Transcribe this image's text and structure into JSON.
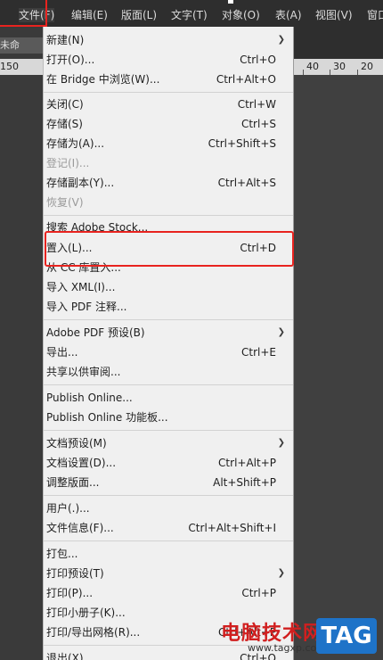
{
  "menubar": {
    "items": [
      {
        "label": "文件(F)"
      },
      {
        "label": "编辑(E)"
      },
      {
        "label": "版面(L)"
      },
      {
        "label": "文字(T)"
      },
      {
        "label": "对象(O)"
      },
      {
        "label": "表(A)"
      },
      {
        "label": "视图(V)"
      },
      {
        "label": "窗口"
      }
    ]
  },
  "document": {
    "tab_label": "未命",
    "ruler_left_text": "150",
    "ruler_right_numbers": [
      "40",
      "30",
      "20"
    ]
  },
  "file_menu": {
    "items": [
      {
        "label": "新建(N)",
        "shortcut": "",
        "submenu": true,
        "disabled": false
      },
      {
        "label": "打开(O)...",
        "shortcut": "Ctrl+O",
        "submenu": false,
        "disabled": false
      },
      {
        "label": "在 Bridge 中浏览(W)...",
        "shortcut": "Ctrl+Alt+O",
        "submenu": false,
        "disabled": false
      },
      {
        "label": "关闭(C)",
        "shortcut": "Ctrl+W",
        "submenu": false,
        "disabled": false
      },
      {
        "label": "存储(S)",
        "shortcut": "Ctrl+S",
        "submenu": false,
        "disabled": false
      },
      {
        "label": "存储为(A)...",
        "shortcut": "Ctrl+Shift+S",
        "submenu": false,
        "disabled": false
      },
      {
        "label": "登记(I)...",
        "shortcut": "",
        "submenu": false,
        "disabled": true
      },
      {
        "label": "存储副本(Y)...",
        "shortcut": "Ctrl+Alt+S",
        "submenu": false,
        "disabled": false
      },
      {
        "label": "恢复(V)",
        "shortcut": "",
        "submenu": false,
        "disabled": true
      },
      {
        "label": "搜索 Adobe Stock...",
        "shortcut": "",
        "submenu": false,
        "disabled": false
      },
      {
        "label": "置入(L)...",
        "shortcut": "Ctrl+D",
        "submenu": false,
        "disabled": false
      },
      {
        "label": "从 CC 库置入...",
        "shortcut": "",
        "submenu": false,
        "disabled": false
      },
      {
        "label": "导入 XML(I)...",
        "shortcut": "",
        "submenu": false,
        "disabled": false
      },
      {
        "label": "导入 PDF 注释...",
        "shortcut": "",
        "submenu": false,
        "disabled": false
      },
      {
        "label": "Adobe PDF 预设(B)",
        "shortcut": "",
        "submenu": true,
        "disabled": false
      },
      {
        "label": "导出...",
        "shortcut": "Ctrl+E",
        "submenu": false,
        "disabled": false
      },
      {
        "label": "共享以供审阅...",
        "shortcut": "",
        "submenu": false,
        "disabled": false
      },
      {
        "label": "Publish Online...",
        "shortcut": "",
        "submenu": false,
        "disabled": false
      },
      {
        "label": "Publish Online 功能板...",
        "shortcut": "",
        "submenu": false,
        "disabled": false
      },
      {
        "label": "文档预设(M)",
        "shortcut": "",
        "submenu": true,
        "disabled": false
      },
      {
        "label": "文档设置(D)...",
        "shortcut": "Ctrl+Alt+P",
        "submenu": false,
        "disabled": false
      },
      {
        "label": "调整版面...",
        "shortcut": "Alt+Shift+P",
        "submenu": false,
        "disabled": false
      },
      {
        "label": "用户(.)...",
        "shortcut": "",
        "submenu": false,
        "disabled": false
      },
      {
        "label": "文件信息(F)...",
        "shortcut": "Ctrl+Alt+Shift+I",
        "submenu": false,
        "disabled": false
      },
      {
        "label": "打包...",
        "shortcut": "",
        "submenu": false,
        "disabled": false
      },
      {
        "label": "打印预设(T)",
        "shortcut": "",
        "submenu": true,
        "disabled": false
      },
      {
        "label": "打印(P)...",
        "shortcut": "Ctrl+P",
        "submenu": false,
        "disabled": false
      },
      {
        "label": "打印小册子(K)...",
        "shortcut": "",
        "submenu": false,
        "disabled": false
      },
      {
        "label": "打印/导出网格(R)...",
        "shortcut": "Ctrl+Alt+P",
        "submenu": false,
        "disabled": false
      },
      {
        "label": "退出(X)",
        "shortcut": "Ctrl+Q",
        "submenu": false,
        "disabled": false
      }
    ]
  },
  "watermark": {
    "title": "电脑技术网",
    "url": "www.tagxp.com",
    "badge": "TAG"
  },
  "colors": {
    "highlight_border": "#e8231f",
    "menu_background": "#f0f0f0",
    "app_background": "#2e2e2e"
  }
}
